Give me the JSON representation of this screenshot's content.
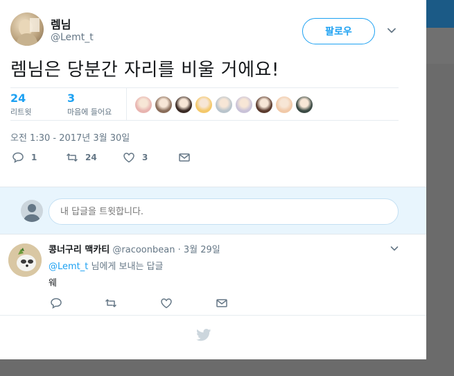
{
  "tweet": {
    "author_name": "렘님",
    "author_handle": "@Lemt_t",
    "follow_label": "팔로우",
    "text": "렘님은 당분간 자리를 비울 거에요!",
    "retweets_count": "24",
    "retweets_label": "리트윗",
    "likes_count": "3",
    "likes_label": "마음에 들어요",
    "timestamp": "오전 1:30 - 2017년 3월 30일",
    "actions": {
      "reply_count": "1",
      "retweet_count": "24",
      "like_count": "3"
    },
    "liker_avatar_colors": [
      "#e8b4b0",
      "#8a6d5a",
      "#3a2a24",
      "#f4c86a",
      "#b9c4cc",
      "#c9c2d8",
      "#5b3b2e",
      "#f1c9a8",
      "#3b4a44"
    ]
  },
  "reply_compose": {
    "placeholder": "내 답글을 트윗합니다."
  },
  "reply": {
    "author_name": "콩너구리 맥카티",
    "author_handle": "@racoonbean",
    "separator": "·",
    "date": "3월 29일",
    "replying_mention": "@Lemt_t",
    "replying_suffix": " 님에게 보내는 답글",
    "text": "웨"
  },
  "icons": {
    "caret": "chevron-down-icon",
    "reply": "reply-icon",
    "retweet": "retweet-icon",
    "like": "heart-icon",
    "dm": "mail-icon",
    "footer": "twitter-bird-icon"
  },
  "colors": {
    "accent": "#1da1f2",
    "muted": "#657786",
    "compose_bg": "#e8f5fd"
  }
}
